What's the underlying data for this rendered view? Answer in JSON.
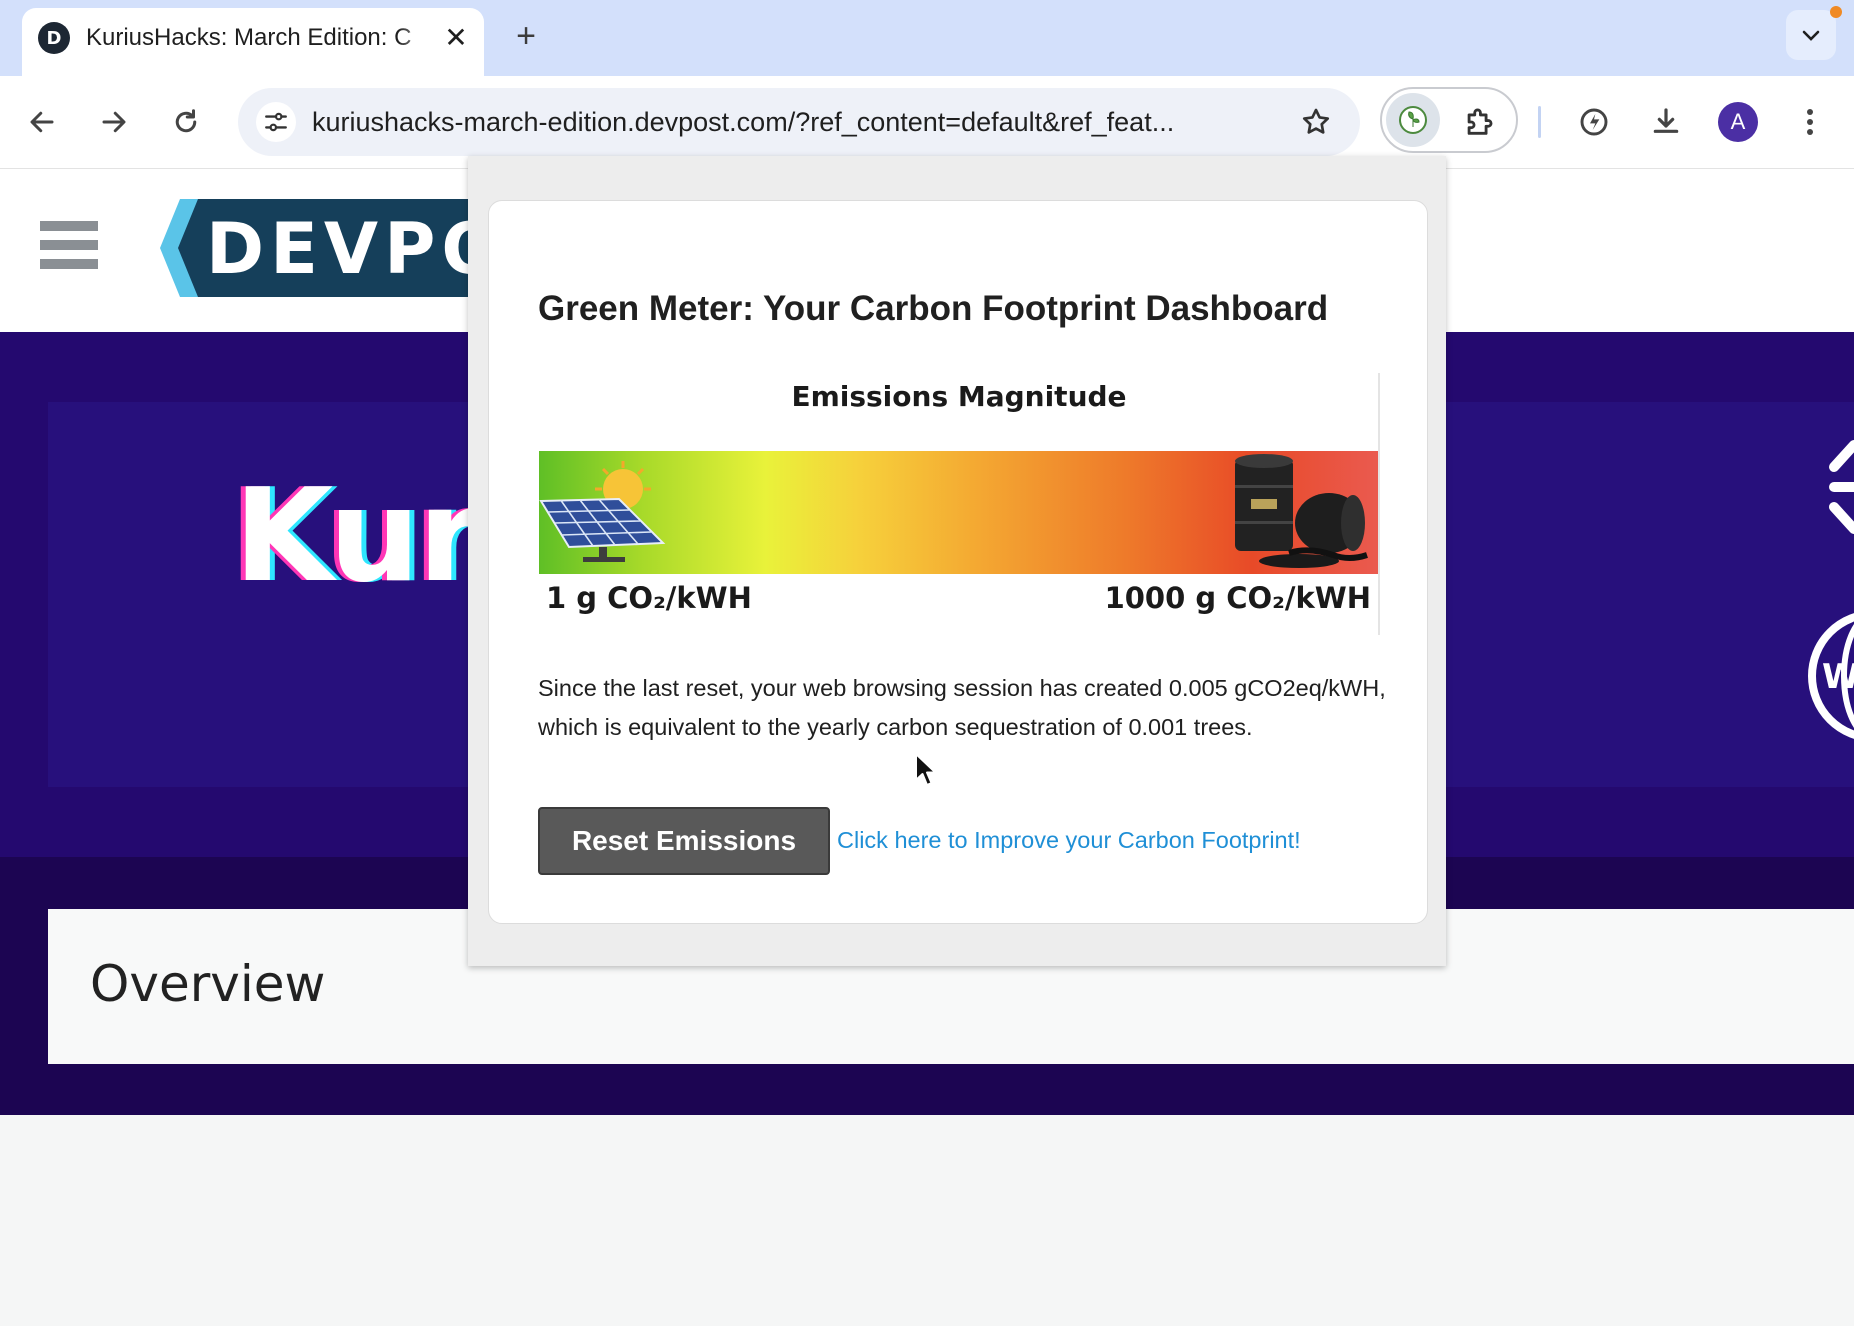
{
  "browser": {
    "tab": {
      "favicon_letter": "D",
      "title": "KuriusHacks: March Edition: C",
      "close_glyph": "✕"
    },
    "new_tab_glyph": "+",
    "url": "kuriushacks-march-edition.devpost.com/?ref_content=default&ref_feat...",
    "avatar_letter": "A"
  },
  "page": {
    "logo_text": "DEVPOST",
    "hero_title": "Kurius",
    "overview_title": "Overview"
  },
  "popup": {
    "title": "Green Meter: Your Carbon Footprint Dashboard",
    "meter": {
      "title": "Emissions Magnitude",
      "min_label": "1 g CO₂/kWH",
      "max_label": "1000 g CO₂/kWH"
    },
    "summary": "Since the last reset, your web browsing session has created 0.005 gCO2eq/kWH, which is equivalent to the yearly carbon sequestration of 0.001 trees.",
    "reset_button": "Reset Emissions",
    "improve_link": "Click here to Improve your Carbon Footprint!"
  },
  "colors": {
    "tabstrip": "#d3e0fb",
    "hero": "#24096f",
    "dark_band": "#1c0552",
    "link": "#1f8fd6",
    "button": "#595959"
  }
}
